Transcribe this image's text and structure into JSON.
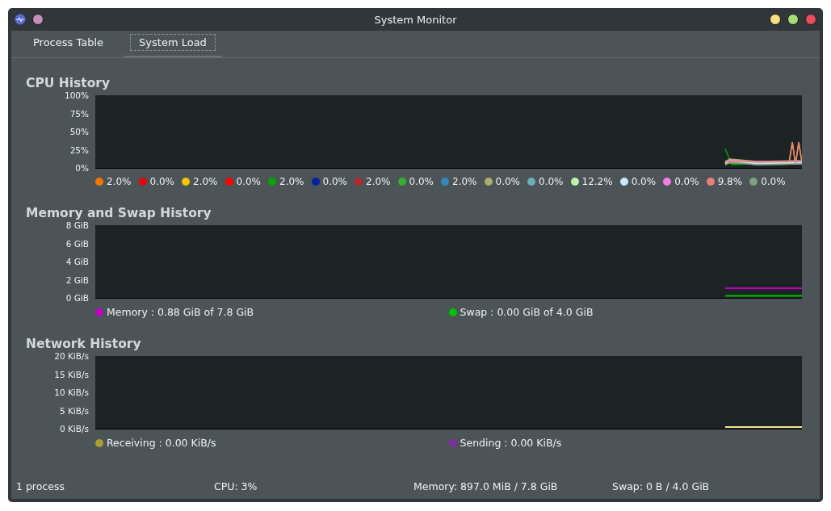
{
  "window": {
    "title": "System Monitor"
  },
  "tabs": [
    {
      "label": "Process Table",
      "selected": false
    },
    {
      "label": "System Load",
      "selected": true
    }
  ],
  "sections": [
    {
      "kind": "cpu",
      "title": "CPU History",
      "y_ticks": [
        "100%",
        "75%",
        "50%",
        "25%",
        "0%"
      ],
      "legend": [
        {
          "label": "2.0%",
          "color": "#f67400"
        },
        {
          "label": "0.0%",
          "color": "#e00a0a"
        },
        {
          "label": "2.0%",
          "color": "#f5c400"
        },
        {
          "label": "0.0%",
          "color": "#ff0000"
        },
        {
          "label": "2.0%",
          "color": "#00a800"
        },
        {
          "label": "0.0%",
          "color": "#0024a0"
        },
        {
          "label": "2.0%",
          "color": "#b32a2a"
        },
        {
          "label": "0.0%",
          "color": "#33b033"
        },
        {
          "label": "2.0%",
          "color": "#2f8ac0"
        },
        {
          "label": "0.0%",
          "color": "#a8b070"
        },
        {
          "label": "0.0%",
          "color": "#6ab0b8"
        },
        {
          "label": "12.2%",
          "color": "#b8f5a8"
        },
        {
          "label": "0.0%",
          "color": "#c8e8ff"
        },
        {
          "label": "0.0%",
          "color": "#f080e0"
        },
        {
          "label": "9.8%",
          "color": "#e8807a"
        },
        {
          "label": "0.0%",
          "color": "#80a080"
        }
      ]
    },
    {
      "kind": "memory",
      "title": "Memory and Swap History",
      "y_ticks": [
        "8 GiB",
        "6 GiB",
        "4 GiB",
        "2 GiB",
        "0 GiB"
      ],
      "legend": [
        {
          "label": "Memory : 0.88 GiB of 7.8 GiB",
          "color": "#c000c0"
        },
        {
          "label": "Swap : 0.00 GiB of 4.0 GiB",
          "color": "#00c000"
        }
      ]
    },
    {
      "kind": "network",
      "title": "Network History",
      "y_ticks": [
        "20 KiB/s",
        "15 KiB/s",
        "10 KiB/s",
        "5 KiB/s",
        "0 KiB/s"
      ],
      "legend": [
        {
          "label": "Receiving : 0.00 KiB/s",
          "color": "#a8a030"
        },
        {
          "label": "Sending : 0.00 KiB/s",
          "color": "#80309a"
        }
      ]
    }
  ],
  "status_bar": [
    "1 process",
    "CPU: 3%",
    "Memory: 897.0 MiB / 7.8 GiB",
    "Swap: 0 B / 4.0 GiB"
  ]
}
